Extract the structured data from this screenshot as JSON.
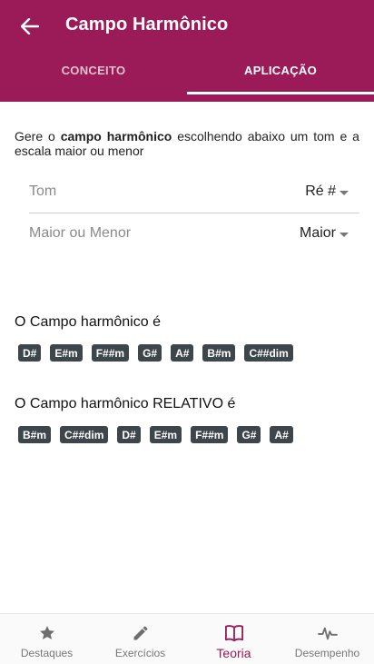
{
  "appbar": {
    "title": "Campo Harmônico"
  },
  "tabs": [
    {
      "label": "CONCEITO"
    },
    {
      "label": "APLICAÇÃO"
    }
  ],
  "intro": {
    "prefix": "Gere o ",
    "bold": "campo harmônico",
    "suffix": " escolhendo abaixo um tom e a escala maior ou menor"
  },
  "fields": {
    "tom": {
      "label": "Tom",
      "value": "Ré #"
    },
    "escala": {
      "label": "Maior ou Menor",
      "value": "Maior"
    }
  },
  "campo": {
    "title": "O Campo harmônico é",
    "chords": [
      "D#",
      "E#m",
      "F##m",
      "G#",
      "A#",
      "B#m",
      "C##dim"
    ]
  },
  "relativo": {
    "title": "O Campo harmônico RELATIVO é",
    "chords": [
      "B#m",
      "C##dim",
      "D#",
      "E#m",
      "F##m",
      "G#",
      "A#"
    ]
  },
  "bottomnav": [
    {
      "label": "Destaques",
      "icon": "star-icon"
    },
    {
      "label": "Exercícios",
      "icon": "pencil-icon"
    },
    {
      "label": "Teoria",
      "icon": "book-icon"
    },
    {
      "label": "Desempenho",
      "icon": "pulse-icon"
    }
  ],
  "colors": {
    "primary": "#9a1b58",
    "chip": "#3d464b"
  }
}
